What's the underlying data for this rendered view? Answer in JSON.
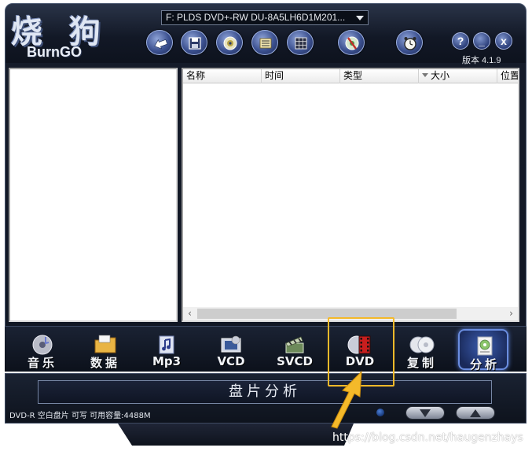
{
  "app": {
    "logo_cn": "烧 狗",
    "logo_en": "BurnGO",
    "version": "版本 4.1.9"
  },
  "drive": {
    "selected": "F: PLDS    DVD+-RW DU-8A5LH6D1M201..."
  },
  "toolbar": {
    "icons": [
      "back-arrow-icon",
      "save-icon",
      "disc-icon",
      "list-icon",
      "grid-icon",
      "disc-tools-icon",
      "clock-icon"
    ]
  },
  "window_buttons": {
    "help": "?",
    "minimize": "_",
    "close": "x"
  },
  "file_list": {
    "columns": [
      "名称",
      "时间",
      "类型",
      "大小",
      "位置"
    ],
    "sorted_column": "大小",
    "rows": []
  },
  "modes": [
    {
      "id": "music",
      "label": "音乐",
      "icon": "music-disc-icon",
      "selected": false
    },
    {
      "id": "data",
      "label": "数据",
      "icon": "data-folder-icon",
      "selected": false
    },
    {
      "id": "mp3",
      "label": "Mp3",
      "icon": "mp3-note-icon",
      "selected": false
    },
    {
      "id": "vcd",
      "label": "VCD",
      "icon": "vcd-film-icon",
      "selected": false
    },
    {
      "id": "svcd",
      "label": "SVCD",
      "icon": "svcd-clapper-icon",
      "selected": false
    },
    {
      "id": "dvd",
      "label": "DVD",
      "icon": "dvd-film-icon",
      "selected": false
    },
    {
      "id": "copy",
      "label": "复制",
      "icon": "copy-discs-icon",
      "selected": false
    },
    {
      "id": "analyze",
      "label": "分析",
      "icon": "analyze-disc-icon",
      "selected": true
    }
  ],
  "panel": {
    "title": "盘片分析",
    "status": "DVD-R 空白盘片 可写 可用容量:4488M"
  },
  "watermark": "https://blog.csdn.net/haugenzhays",
  "colors": {
    "chrome_dark": "#121826",
    "accent_blue": "#3b5cb0",
    "highlight": "#f4b92a"
  }
}
